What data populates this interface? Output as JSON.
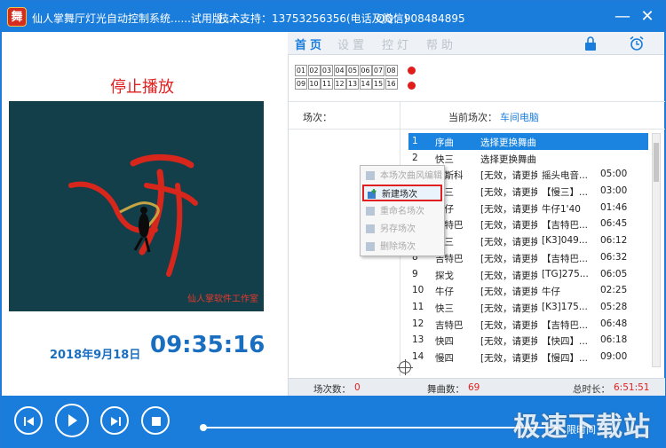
{
  "titlebar": {
    "logo_char": "舞",
    "title": "仙人掌舞厅灯光自动控制系统......试用版......",
    "support": "技术支持：13753256356(电话及微信)",
    "qq": "QQ：908484895",
    "minimize_glyph": "—",
    "close_glyph": "✕"
  },
  "nav": {
    "tabs": [
      {
        "label": "首页",
        "active": true
      },
      {
        "label": "设置",
        "active": false
      },
      {
        "label": "控灯",
        "active": false
      },
      {
        "label": "帮助",
        "active": false
      }
    ],
    "icons": [
      "lock-icon",
      "alarm-clock-icon"
    ]
  },
  "left": {
    "status": "停止播放",
    "video_caption": "仙人掌软件工作室",
    "date": "2018年9月18日",
    "time": "09:35:16",
    "collapse_glyph": "〈"
  },
  "channels": {
    "row1": [
      "01",
      "02",
      "03",
      "04",
      "05",
      "06",
      "07",
      "08"
    ],
    "row2": [
      "09",
      "10",
      "11",
      "12",
      "13",
      "14",
      "15",
      "16"
    ]
  },
  "scene": {
    "scene_label": "场次：",
    "current_label": "当前场次：",
    "current_value": "车间电脑"
  },
  "songs": [
    {
      "no": "1",
      "type": "序曲",
      "status": "选择更换舞曲",
      "name": "",
      "dur": ""
    },
    {
      "no": "2",
      "type": "快三",
      "status": "选择更换舞曲",
      "name": "",
      "dur": ""
    },
    {
      "no": "3",
      "type": "迪斯科",
      "status": "[无效，请更换]",
      "name": "摇头电音...",
      "dur": "05:00"
    },
    {
      "no": "4",
      "type": "慢三",
      "status": "[无效，请更换]",
      "name": "【慢三】...",
      "dur": "03:00"
    },
    {
      "no": "5",
      "type": "牛仔",
      "status": "[无效，请更换]",
      "name": "牛仔1'40",
      "dur": "01:46"
    },
    {
      "no": "6",
      "type": "吉特巴",
      "status": "[无效，请更换]",
      "name": "【吉特巴...",
      "dur": "06:45"
    },
    {
      "no": "7",
      "type": "快三",
      "status": "[无效，请更换]",
      "name": "[K3]049...",
      "dur": "06:12"
    },
    {
      "no": "8",
      "type": "吉特巴",
      "status": "[无效，请更换]",
      "name": "【吉特巴...",
      "dur": "06:32"
    },
    {
      "no": "9",
      "type": "探戈",
      "status": "[无效，请更换]",
      "name": "[TG]275...",
      "dur": "06:05"
    },
    {
      "no": "10",
      "type": "牛仔",
      "status": "[无效，请更换]",
      "name": "牛仔",
      "dur": "02:25"
    },
    {
      "no": "11",
      "type": "快三",
      "status": "[无效，请更换]",
      "name": "[K3]175...",
      "dur": "05:28"
    },
    {
      "no": "12",
      "type": "吉特巴",
      "status": "[无效，请更换]",
      "name": "【吉特巴...",
      "dur": "06:48"
    },
    {
      "no": "13",
      "type": "快四",
      "status": "[无效，请更换]",
      "name": "【快四】...",
      "dur": "06:18"
    },
    {
      "no": "14",
      "type": "慢四",
      "status": "[无效，请更换]",
      "name": "【慢四】...",
      "dur": "09:00"
    }
  ],
  "context_menu": {
    "items": [
      {
        "label": "本场次曲风编辑",
        "active": false,
        "icon": "edit-icon"
      },
      {
        "label": "新建场次",
        "active": true,
        "icon": "new-scene-icon"
      },
      {
        "label": "重命名场次",
        "active": false,
        "icon": "rename-icon"
      },
      {
        "label": "另存场次",
        "active": false,
        "icon": "save-as-icon"
      },
      {
        "label": "删除场次",
        "active": false,
        "icon": "delete-icon"
      }
    ]
  },
  "status": {
    "scene_count_label": "场次数：",
    "scene_count": "0",
    "song_count_label": "舞曲数：",
    "song_count": "69",
    "total_label": "总时长：",
    "total": "6:51:51"
  },
  "player": {
    "buttons": [
      "previous-icon",
      "play-icon",
      "next-icon",
      "stop-icon"
    ],
    "trial_text": "限时间",
    "watermark": "极速下载站"
  },
  "colors": {
    "accent": "#1a7ddb",
    "alert": "#e02020",
    "selection": "#1a84e0"
  }
}
